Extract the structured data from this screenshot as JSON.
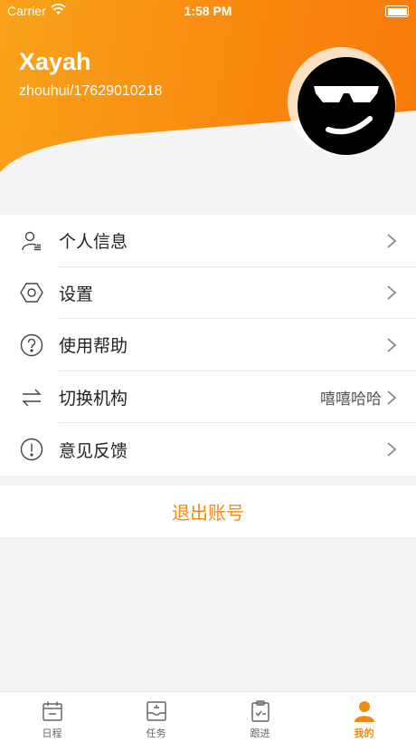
{
  "status_bar": {
    "carrier": "Carrier",
    "time": "1:58 PM"
  },
  "profile": {
    "name": "Xayah",
    "account": "zhouhui/17629010218"
  },
  "menu": {
    "items": [
      {
        "label": "个人信息",
        "value": "",
        "icon": "person-info-icon"
      },
      {
        "label": "设置",
        "value": "",
        "icon": "settings-hexagon-icon"
      },
      {
        "label": "使用帮助",
        "value": "",
        "icon": "help-question-icon"
      },
      {
        "label": "切换机构",
        "value": "嘻嘻哈哈",
        "icon": "switch-arrows-icon"
      },
      {
        "label": "意见反馈",
        "value": "",
        "icon": "feedback-exclamation-icon"
      }
    ]
  },
  "logout": {
    "label": "退出账号"
  },
  "tabbar": {
    "tabs": [
      {
        "label": "日程",
        "icon": "calendar-icon",
        "active": false
      },
      {
        "label": "任务",
        "icon": "task-tray-icon",
        "active": false
      },
      {
        "label": "跟进",
        "icon": "clipboard-check-icon",
        "active": false
      },
      {
        "label": "我的",
        "icon": "user-profile-icon",
        "active": true
      }
    ]
  },
  "colors": {
    "accent": "#f58a13",
    "header_start": "#f9a21a",
    "header_end": "#f77908"
  }
}
